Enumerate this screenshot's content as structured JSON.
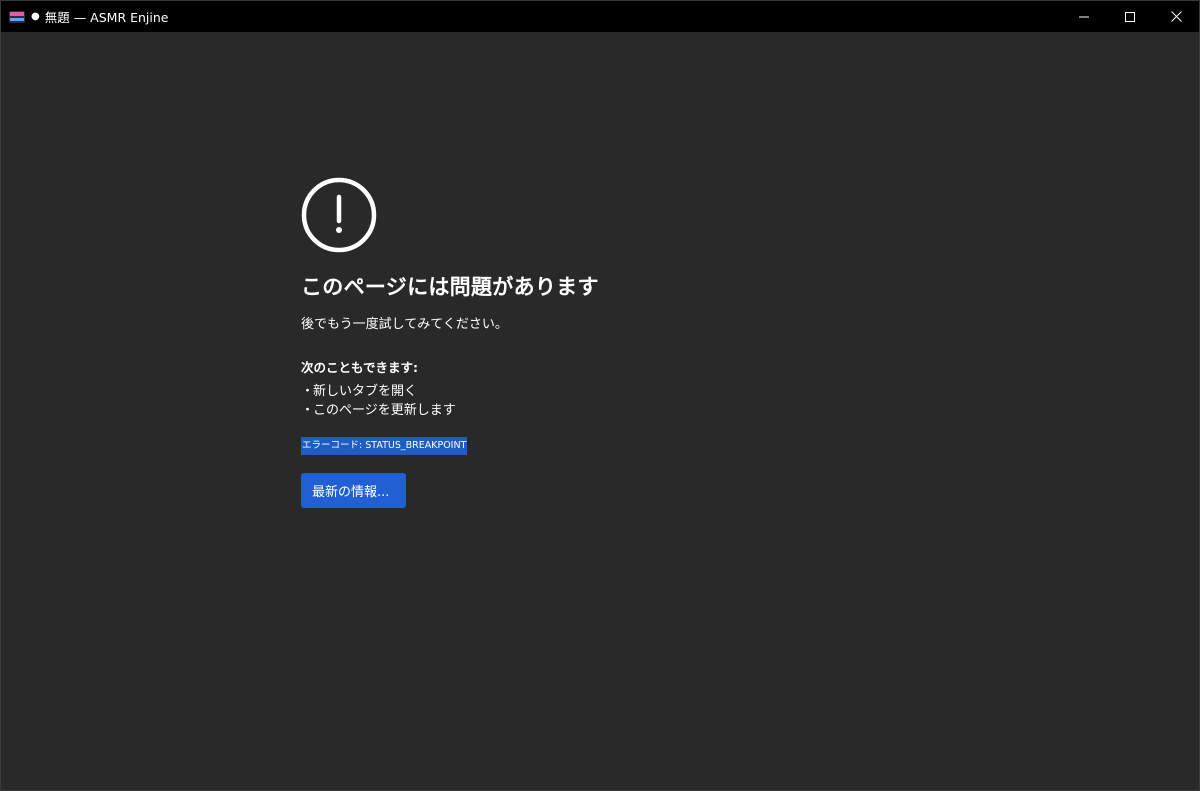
{
  "window": {
    "title_dot": "●",
    "title": "無題 — ASMR Enjine",
    "controls": {
      "minimize": "minimize-icon",
      "maximize": "maximize-icon",
      "close": "close-icon"
    }
  },
  "error_page": {
    "icon": "warning-circle-icon",
    "heading": "このページには問題があります",
    "message": "後でもう一度試してみてください。",
    "alternatives_title": "次のこともできます:",
    "alternatives": [
      {
        "bullet": "・",
        "label": "新しいタブを開く"
      },
      {
        "bullet": "・",
        "label": "このページを更新します"
      }
    ],
    "error_code": "エラーコード: STATUS_BREAKPOINT",
    "learn_more_button": "最新の情報..."
  },
  "colors": {
    "titlebar": "#000000",
    "background": "#292929",
    "accent": "#2060d4",
    "selection": "#1f5cc4",
    "text": "#ffffff"
  }
}
